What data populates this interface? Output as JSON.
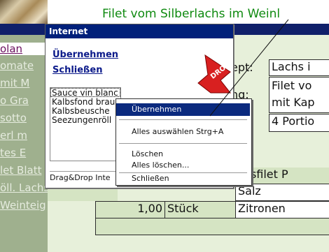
{
  "page": {
    "title": "Filet vom Silberlachs im Weinl"
  },
  "sidebar": {
    "items": [
      "olan",
      "omate",
      "mit M",
      "o Gra",
      "sotto",
      "erl m",
      "tes E",
      "let Blatt",
      "öll. Lachs",
      "Weinteig"
    ]
  },
  "recipe": {
    "label_dept": "ept:",
    "value_dept": "Lachs i",
    "label_ng": "ng:",
    "value_ng_1": "Filet vo",
    "value_ng_2": "mit Kap",
    "value_portions": "4 Portio",
    "row_fish": "chsfilet P",
    "row_salt": "Salz",
    "row_qty": "1,00",
    "row_unit": "Stück",
    "row_item": "Zitronen"
  },
  "internet_panel": {
    "header": "Internet",
    "apply_link": "Übernehmen",
    "close_link": "Schließen",
    "drop_sign": "DROP",
    "list_items": [
      "Sauce vin blanc",
      "Kalbsfond brau",
      "Kalbsbeusche",
      "Seezungenröll"
    ],
    "status": "Drag&Drop Inte"
  },
  "context_menu": {
    "items": [
      "Übernehmen",
      "Alles auswählen  Strg+A",
      "Löschen",
      "Alles löschen...",
      "Schließen"
    ],
    "highlighted": "Übernehmen"
  },
  "colors": {
    "title_green": "#0f8a10",
    "header_blue": "#00207a",
    "menu_highlight": "#0b2a7e",
    "sidebar_green": "#9fb08e",
    "drop_red": "#d82020"
  }
}
